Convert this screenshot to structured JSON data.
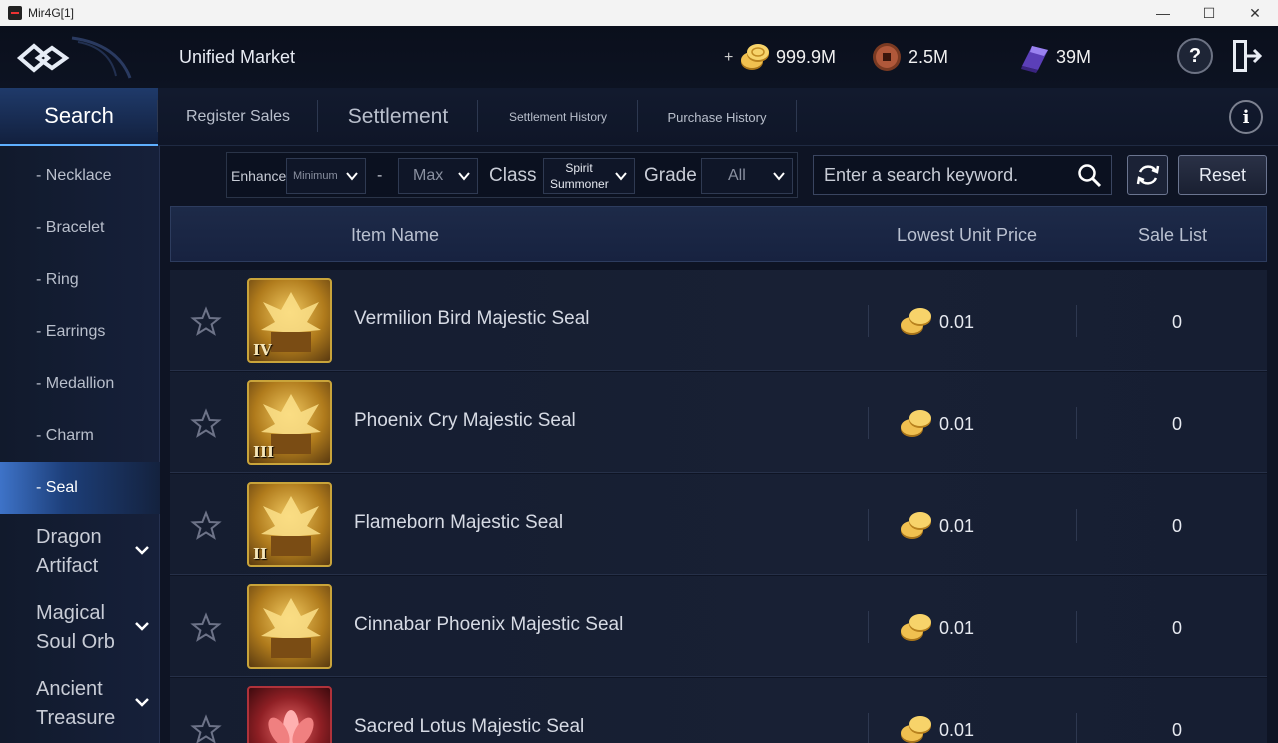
{
  "window": {
    "title": "Mir4G[1]",
    "controls": {
      "minimize": "—",
      "maximize": "☐",
      "close": "✕"
    }
  },
  "header": {
    "title": "Unified Market",
    "add_symbol": "+",
    "currencies": [
      {
        "icon": "gold-coin-icon",
        "value": "999.9M"
      },
      {
        "icon": "copper-coin-icon",
        "value": "2.5M"
      },
      {
        "icon": "darksteel-icon",
        "value": "39M"
      }
    ],
    "help_label": "?",
    "info_label": "i"
  },
  "tabs": [
    {
      "label": "Search",
      "active": true
    },
    {
      "label": "Register Sales",
      "active": false
    },
    {
      "label": "Settlement",
      "active": false
    },
    {
      "label": "Settlement History",
      "active": false
    },
    {
      "label": "Purchase History",
      "active": false
    }
  ],
  "sidebar": {
    "items": [
      {
        "label": "- Necklace",
        "active": false
      },
      {
        "label": "- Bracelet",
        "active": false
      },
      {
        "label": "- Ring",
        "active": false
      },
      {
        "label": "- Earrings",
        "active": false
      },
      {
        "label": "- Medallion",
        "active": false
      },
      {
        "label": "- Charm",
        "active": false
      },
      {
        "label": "- Seal",
        "active": true
      }
    ],
    "groups": [
      {
        "line1": "Dragon",
        "line2": "Artifact"
      },
      {
        "line1": "Magical",
        "line2": "Soul Orb"
      },
      {
        "line1": "Ancient",
        "line2": "Treasure"
      }
    ]
  },
  "filters": {
    "enhance_label": "Enhance",
    "enhance_min": "Minimum",
    "dash": "-",
    "enhance_max": "Max",
    "class_label": "Class",
    "class_line1": "Spirit",
    "class_line2": "Summoner",
    "grade_label": "Grade",
    "grade_value": "All"
  },
  "search": {
    "placeholder": "Enter a search keyword.",
    "reset_label": "Reset"
  },
  "table": {
    "columns": {
      "name": "Item Name",
      "price": "Lowest Unit Price",
      "list": "Sale List"
    },
    "rows": [
      {
        "tier": "IV",
        "name": "Vermilion Bird Majestic Seal",
        "price": "0.01",
        "count": "0",
        "icon": "phoenix-seal-icon"
      },
      {
        "tier": "III",
        "name": "Phoenix Cry Majestic Seal",
        "price": "0.01",
        "count": "0",
        "icon": "phoenix-seal-icon"
      },
      {
        "tier": "II",
        "name": "Flameborn Majestic Seal",
        "price": "0.01",
        "count": "0",
        "icon": "phoenix-seal-icon"
      },
      {
        "tier": "",
        "name": "Cinnabar Phoenix Majestic Seal",
        "price": "0.01",
        "count": "0",
        "icon": "phoenix-seal-icon"
      },
      {
        "tier": "",
        "name": "Sacred Lotus Majestic Seal",
        "price": "0.01",
        "count": "0",
        "icon": "lotus-seal-icon"
      }
    ]
  },
  "colors": {
    "accent": "#5fb0ff",
    "active_tab": "#1f3a6a",
    "gold": "#d8a83a"
  }
}
